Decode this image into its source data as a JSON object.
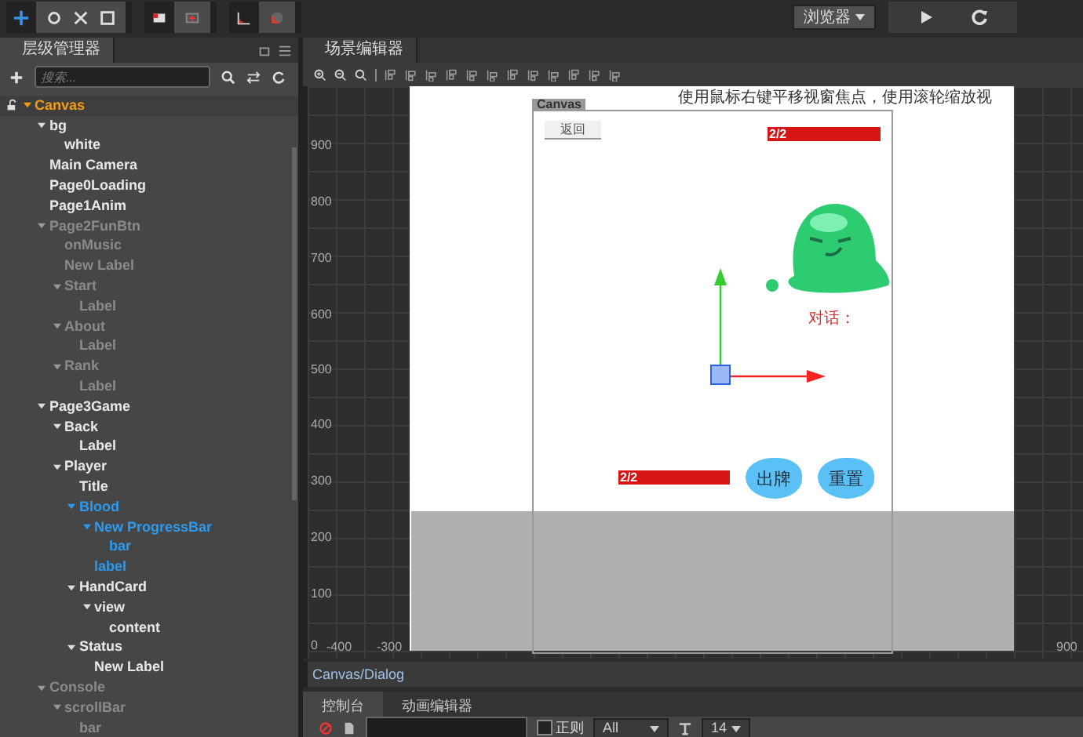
{
  "top_bar": {
    "platform_dropdown": "浏览器"
  },
  "hierarchy": {
    "title": "层级管理器",
    "search": {
      "placeholder": "搜索..."
    },
    "tree": [
      {
        "label": "Canvas",
        "disabled": false,
        "selected": false,
        "children": [
          {
            "label": "bg",
            "disabled": false,
            "selected": false,
            "children": [
              {
                "label": "white",
                "disabled": false,
                "selected": false
              }
            ]
          },
          {
            "label": "Main Camera",
            "disabled": false,
            "selected": false
          },
          {
            "label": "Page0Loading",
            "disabled": false,
            "selected": false
          },
          {
            "label": "Page1Anim",
            "disabled": false,
            "selected": false
          },
          {
            "label": "Page2FunBtn",
            "disabled": true,
            "selected": false,
            "children": [
              {
                "label": "onMusic",
                "disabled": true,
                "selected": false
              },
              {
                "label": "New Label",
                "disabled": true,
                "selected": false
              },
              {
                "label": "Start",
                "disabled": true,
                "selected": false,
                "children": [
                  {
                    "label": "Label",
                    "disabled": true,
                    "selected": false
                  }
                ]
              },
              {
                "label": "About",
                "disabled": true,
                "selected": false,
                "children": [
                  {
                    "label": "Label",
                    "disabled": true,
                    "selected": false
                  }
                ]
              },
              {
                "label": "Rank",
                "disabled": true,
                "selected": false,
                "children": [
                  {
                    "label": "Label",
                    "disabled": true,
                    "selected": false
                  }
                ]
              }
            ]
          },
          {
            "label": "Page3Game",
            "disabled": false,
            "selected": false,
            "children": [
              {
                "label": "Back",
                "disabled": false,
                "selected": false,
                "children": [
                  {
                    "label": "Label",
                    "disabled": false,
                    "selected": false
                  }
                ]
              },
              {
                "label": "Player",
                "disabled": false,
                "selected": false,
                "children": [
                  {
                    "label": "Title",
                    "disabled": false,
                    "selected": false
                  },
                  {
                    "label": "Blood",
                    "disabled": false,
                    "selected": true,
                    "children": [
                      {
                        "label": "New ProgressBar",
                        "disabled": false,
                        "selected": true,
                        "children": [
                          {
                            "label": "bar",
                            "disabled": false,
                            "selected": true
                          }
                        ]
                      },
                      {
                        "label": "label",
                        "disabled": false,
                        "selected": true
                      }
                    ]
                  },
                  {
                    "label": "HandCard",
                    "disabled": false,
                    "selected": false,
                    "children": [
                      {
                        "label": "view",
                        "disabled": false,
                        "selected": false,
                        "children": [
                          {
                            "label": "content",
                            "disabled": false,
                            "selected": false
                          }
                        ]
                      }
                    ]
                  },
                  {
                    "label": "Status",
                    "disabled": false,
                    "selected": false,
                    "children": [
                      {
                        "label": "New Label",
                        "disabled": false,
                        "selected": false
                      }
                    ]
                  }
                ]
              }
            ]
          },
          {
            "label": "Console",
            "disabled": true,
            "selected": false,
            "children": [
              {
                "label": "scrollBar",
                "disabled": true,
                "selected": false,
                "children": [
                  {
                    "label": "bar",
                    "disabled": true,
                    "selected": false
                  }
                ]
              }
            ]
          }
        ]
      }
    ]
  },
  "scene_editor": {
    "tab": "场景编辑器",
    "hint": "使用鼠标右键平移视窗焦点，使用滚轮缩放视",
    "y_ruler": [
      "900",
      "800",
      "700",
      "600",
      "500",
      "400",
      "300",
      "200",
      "100",
      "0"
    ],
    "x_ruler": [
      "-400",
      "-300",
      "900"
    ],
    "canvas_label": "Canvas",
    "back_button": "返回",
    "top_progress": {
      "text": "2/2",
      "level": 1
    },
    "dialog_label": "对话：",
    "bottom_progress": {
      "text": "2/2",
      "level": 1
    },
    "action_buttons": [
      "出牌",
      "重置"
    ]
  },
  "path_bar": "Canvas/Dialog",
  "bottom_tabs": [
    {
      "label": "控制台",
      "selected": true
    },
    {
      "label": "动画编辑器",
      "selected": false
    }
  ],
  "console_toolbar": {
    "regex": {
      "label": "正则",
      "checked": false
    },
    "level_dropdown": "All",
    "font_size_dropdown": "14"
  }
}
